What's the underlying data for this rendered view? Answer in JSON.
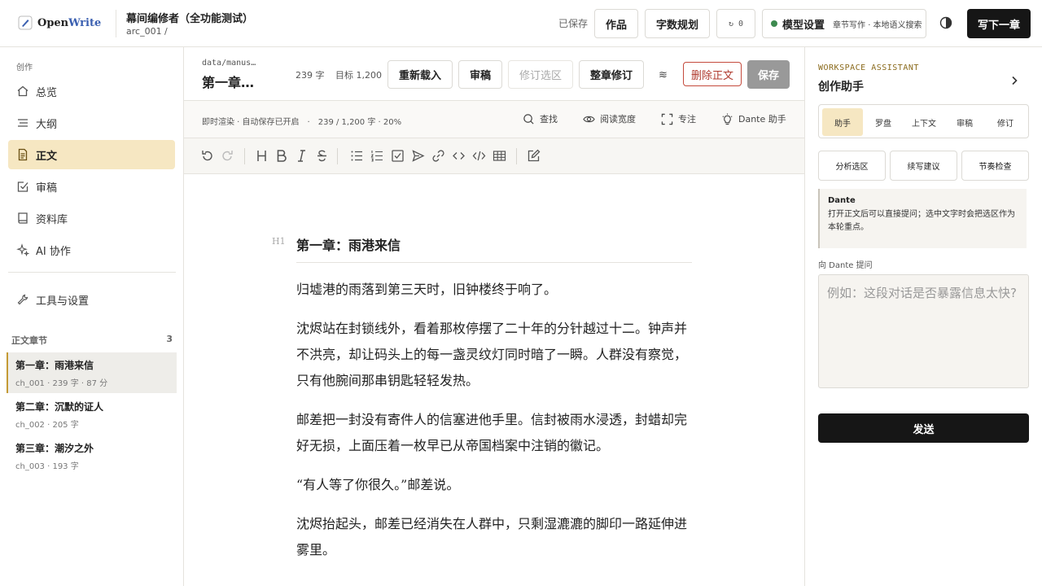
{
  "app": {
    "brand_prefix": "Open",
    "brand_suffix": "Write",
    "project_title": "幕间编修者（全功能测试）",
    "project_path": "arc_001 /"
  },
  "topbar": {
    "saved_status": "已保存",
    "works_label": "作品",
    "wordplan_label": "字数规划",
    "sync_label": "↻ 0",
    "model_label": "模型设置",
    "model_sub": "章节写作 · 本地语义搜索",
    "next_chapter_label": "写下一章"
  },
  "sidebar": {
    "section_label": "创作",
    "nav": [
      {
        "label": "总览",
        "icon": "home-icon"
      },
      {
        "label": "大纲",
        "icon": "outline-icon"
      },
      {
        "label": "正文",
        "icon": "document-icon",
        "active": true
      },
      {
        "label": "审稿",
        "icon": "review-check-icon"
      },
      {
        "label": "资料库",
        "icon": "book-icon"
      },
      {
        "label": "AI 协作",
        "icon": "sparkle-icon"
      }
    ],
    "tools_label": "工具与设置",
    "chapters_header": "正文章节",
    "chapters_count": "3",
    "chapters": [
      {
        "title": "第一章：雨港来信",
        "meta": "ch_001 · 239 字 · 87 分",
        "active": true
      },
      {
        "title": "第二章：沉默的证人",
        "meta": "ch_002 · 205 字"
      },
      {
        "title": "第三章：潮汐之外",
        "meta": "ch_003 · 193 字"
      }
    ]
  },
  "editor": {
    "file_path": "data/manus…",
    "file_title": "第一章…",
    "word_count": "239 字",
    "target": "目标 1,200",
    "reload_label": "重新载入",
    "review_label": "审稿",
    "revise_selection_label": "修订选区",
    "full_revise_label": "整章修订",
    "wave_glyph": "≋",
    "delete_label": "删除正文",
    "save_label": "保存",
    "status_text": "即时渲染 · 自动保存已开启　·　239 / 1,200 字 · 20%",
    "tools": {
      "find": "查找",
      "read_width": "阅读宽度",
      "focus": "专注",
      "dante": "Dante 助手"
    },
    "h1_marker": "H1",
    "heading": "第一章：雨港来信",
    "paragraphs": [
      "归墟港的雨落到第三天时，旧钟楼终于响了。",
      "沈烬站在封锁线外，看着那枚停摆了二十年的分针越过十二。钟声并不洪亮，却让码头上的每一盏灵纹灯同时暗了一瞬。人群没有察觉，只有他腕间那串钥匙轻轻发热。",
      "邮差把一封没有寄件人的信塞进他手里。信封被雨水浸透，封蜡却完好无损，上面压着一枚早已从帝国档案中注销的徽记。",
      "“有人等了你很久。”邮差说。",
      "沈烬抬起头，邮差已经消失在人群中，只剩湿漉漉的脚印一路延伸进雾里。"
    ]
  },
  "assistant": {
    "section_label": "WORKSPACE ASSISTANT",
    "title": "创作助手",
    "tabs": [
      "助手",
      "罗盘",
      "上下文",
      "审稿",
      "修订"
    ],
    "actions": [
      "分析选区",
      "续写建议",
      "节奏检查"
    ],
    "message_name": "Dante",
    "message_body": "打开正文后可以直接提问；选中文字时会把选区作为本轮重点。",
    "ask_label": "向 Dante 提问",
    "ask_placeholder": "例如：这段对话是否暴露信息太快?",
    "send_label": "发送"
  }
}
